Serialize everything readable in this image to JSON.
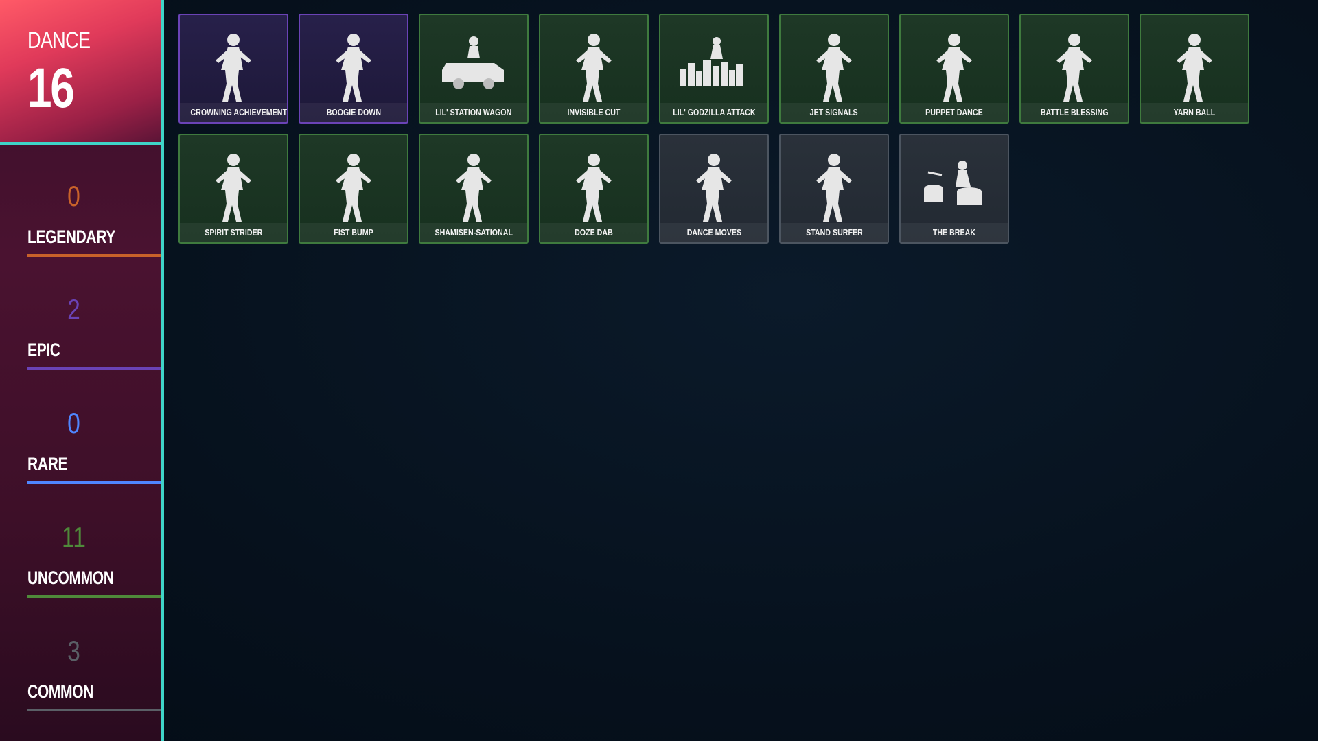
{
  "header": {
    "label": "DANCE",
    "count": "16",
    "accent": "#3fd4c8"
  },
  "rarities": [
    {
      "count": "0",
      "label": "LEGENDARY",
      "color": "#c8622a"
    },
    {
      "count": "2",
      "label": "EPIC",
      "color": "#6a43b6"
    },
    {
      "count": "0",
      "label": "RARE",
      "color": "#4f86ff"
    },
    {
      "count": "11",
      "label": "UNCOMMON",
      "color": "#4f8a3a"
    },
    {
      "count": "3",
      "label": "COMMON",
      "color": "#5a5f66"
    }
  ],
  "items": [
    {
      "name": "CROWNING ACHIEVEMENT",
      "rarity": "epic",
      "icon": "crowning-achievement-icon"
    },
    {
      "name": "BOOGIE DOWN",
      "rarity": "epic",
      "icon": "boogie-down-icon"
    },
    {
      "name": "LIL' STATION WAGON",
      "rarity": "uncommon",
      "icon": "station-wagon-icon"
    },
    {
      "name": "INVISIBLE CUT",
      "rarity": "uncommon",
      "icon": "invisible-cut-icon"
    },
    {
      "name": "LIL' GODZILLA ATTACK",
      "rarity": "uncommon",
      "icon": "godzilla-attack-icon"
    },
    {
      "name": "JET SIGNALS",
      "rarity": "uncommon",
      "icon": "jet-signals-icon"
    },
    {
      "name": "PUPPET DANCE",
      "rarity": "uncommon",
      "icon": "puppet-dance-icon"
    },
    {
      "name": "BATTLE BLESSING",
      "rarity": "uncommon",
      "icon": "battle-blessing-icon"
    },
    {
      "name": "YARN BALL",
      "rarity": "uncommon",
      "icon": "yarn-ball-icon"
    },
    {
      "name": "SPIRIT STRIDER",
      "rarity": "uncommon",
      "icon": "spirit-strider-icon"
    },
    {
      "name": "FIST BUMP",
      "rarity": "uncommon",
      "icon": "fist-bump-icon"
    },
    {
      "name": "SHAMISEN-SATIONAL",
      "rarity": "uncommon",
      "icon": "shamisen-icon"
    },
    {
      "name": "DOZE DAB",
      "rarity": "uncommon",
      "icon": "doze-dab-icon"
    },
    {
      "name": "DANCE MOVES",
      "rarity": "common",
      "icon": "dance-moves-icon"
    },
    {
      "name": "STAND SURFER",
      "rarity": "common",
      "icon": "stand-surfer-icon"
    },
    {
      "name": "THE BREAK",
      "rarity": "common",
      "icon": "the-break-icon"
    }
  ]
}
